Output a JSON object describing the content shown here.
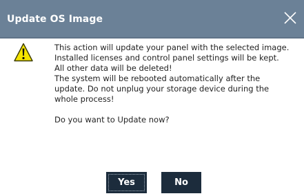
{
  "dialog": {
    "title": "Update OS Image",
    "close_icon": "close-icon",
    "warning_icon": "warning-triangle-icon",
    "message_lines": [
      "This action will update your panel with the selected image.",
      "Installed licenses and control panel settings will be kept.",
      "All other data will be deleted!",
      "The system will be rebooted automatically after the update. Do not unplug your storage device during the whole process!"
    ],
    "question": "Do you want to Update now?",
    "yes_label": "Yes",
    "no_label": "No",
    "colors": {
      "titlebar": "#6b8197",
      "button": "#1c2c3c",
      "warning_fill": "#f5e400"
    }
  }
}
